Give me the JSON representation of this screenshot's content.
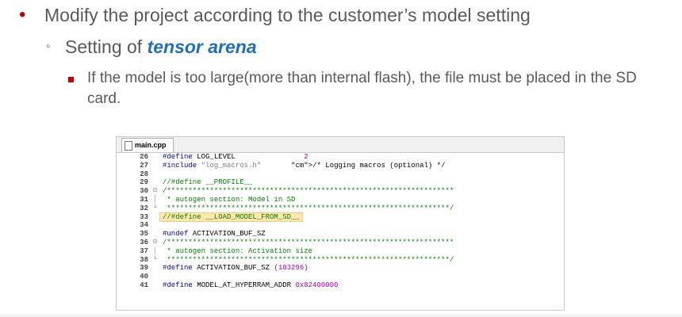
{
  "slide": {
    "bullet1": "Modify the project according to the customer’s model setting",
    "bullet2_prefix": "Setting of ",
    "bullet2_emphasis": "tensor arena",
    "bullet3": "If the model is too large(more than internal flash), the file must be placed in the SD card."
  },
  "editor": {
    "tab_label": "main.cpp",
    "lines": [
      {
        "num": "26",
        "text": "#define LOG_LEVEL                2"
      },
      {
        "num": "27",
        "text": "#include \"log_macros.h\"       /* Logging macros (optional) */"
      },
      {
        "num": "28",
        "text": ""
      },
      {
        "num": "29",
        "text": "//#define __PROFILE__"
      },
      {
        "num": "30",
        "text": "/*******************************************************************"
      },
      {
        "num": "31",
        "text": " * autogen section: Model in SD"
      },
      {
        "num": "32",
        "text": " ******************************************************************/"
      },
      {
        "num": "33",
        "text": "//#define __LOAD_MODEL_FROM_SD__"
      },
      {
        "num": "34",
        "text": ""
      },
      {
        "num": "35",
        "text": "#undef ACTIVATION_BUF_SZ"
      },
      {
        "num": "36",
        "text": "/*******************************************************************"
      },
      {
        "num": "37",
        "text": " * autogen section: Activation size"
      },
      {
        "num": "38",
        "text": " ******************************************************************/"
      },
      {
        "num": "39",
        "text": "#define ACTIVATION_BUF_SZ (183296)"
      },
      {
        "num": "40",
        "text": ""
      },
      {
        "num": "41",
        "text": "#define MODEL_AT_HYPERRAM_ADDR 0x82400000"
      }
    ]
  },
  "colors": {
    "bullet_red": "#c00000",
    "emphasis_blue": "#1f6fbf",
    "highlight": "#fde8b2"
  }
}
